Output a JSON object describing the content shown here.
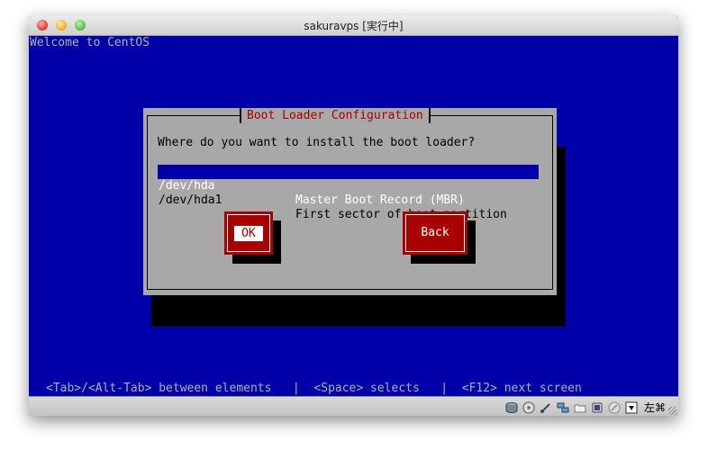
{
  "window": {
    "title": "sakuravps [実行中]"
  },
  "console": {
    "welcome": "Welcome to CentOS",
    "helpline": "<Tab>/<Alt-Tab> between elements   |  <Space> selects   |  <F12> next screen"
  },
  "dialog": {
    "title": "Boot Loader Configuration",
    "prompt": "Where do you want to install the boot loader?",
    "options": [
      {
        "device": "/dev/hda",
        "description": "Master Boot Record (MBR)",
        "selected": true
      },
      {
        "device": "/dev/hda1",
        "description": "First sector of boot partition",
        "selected": false
      }
    ],
    "buttons": {
      "ok": "OK",
      "back": "Back"
    }
  },
  "statusbar": {
    "icons": [
      "hard-disk-icon",
      "cd-rom-icon",
      "usb-icon",
      "network-icon",
      "shared-folder-icon",
      "display-icon",
      "mouse-integration-icon",
      "download-arrow-icon"
    ],
    "host_key": "左⌘"
  },
  "colors": {
    "console_bg": "#0000a8",
    "dialog_bg": "#a8a8a8",
    "accent_red": "#a80000"
  }
}
